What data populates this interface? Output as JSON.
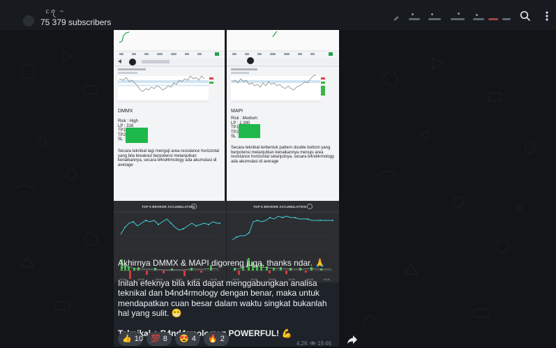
{
  "header": {
    "channel_name": "ᥴꪖ ~",
    "subscribers": "75 379 subscribers"
  },
  "post": {
    "left_card": {
      "ticker": "DMMX",
      "risk": "Risk : High",
      "lp": "LP : 316",
      "tp1": "TP1",
      "tp2": "TP2",
      "sl": "SL :",
      "desc": "Secara teknikal lagi menguji area resistance horizontal yang bila breakout berpotensi melanjutkan kenaikannya, secara b4nd4rmology ada akumulasi di average"
    },
    "right_card": {
      "ticker": "MAPI",
      "risk": "Risk : Medium",
      "lp": "LP : 1.390",
      "tp1": "TP1",
      "tp2": "TP2",
      "sl": "SL :",
      "desc": "Secara teknikal terbentuk pattern double bottom yang berpotensi melanjutkan kenaikannya menuju area resistance horizontal selanjutnya, secara b4nd4rmology ada akumulasi di average"
    },
    "panel_title": "TOP 5 BROKER ACCUMULATION",
    "message": {
      "line1": "Akhirnya DMMX & MAPI digoreng juga, thanks ndar. 🙏",
      "line2": "Inilah efeknya bila kita dapat menggabungkan analisa teknikal dan b4nd4rmology dengan benar, maka untuk mendapatkan cuan besar dalam waktu singkat bukanlah hal yang sulit. 😁",
      "line3": "Teknikal + B4nd4rmology = POWERFUL! 💪"
    },
    "reactions": [
      {
        "emoji": "👍",
        "count": "10"
      },
      {
        "emoji": "💯",
        "count": "8"
      },
      {
        "emoji": "😍",
        "count": "4"
      },
      {
        "emoji": "🔥",
        "count": "2"
      }
    ],
    "views": "4,2K",
    "time": "19:46"
  },
  "colors": {
    "accent_green": "#1fb84a",
    "line_cyan": "#3ed0d8",
    "bar_green": "#43b548",
    "bar_red": "#d23c3c"
  },
  "icons": [
    "search-icon",
    "more-vert-icon",
    "share-icon",
    "eye-icon"
  ]
}
